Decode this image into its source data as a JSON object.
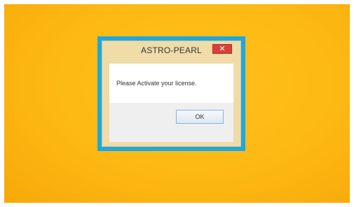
{
  "dialog": {
    "title": "ASTRO-PEARL",
    "message": "Please Activate your license.",
    "ok_label": "OK",
    "close_glyph": "✕"
  },
  "colors": {
    "desktop_background": "#fdb813",
    "highlight_frame": "#1ea7e1",
    "dialog_frame": "#efdca9",
    "close_button": "#d8413a"
  },
  "icons": {
    "close": "close-icon"
  }
}
